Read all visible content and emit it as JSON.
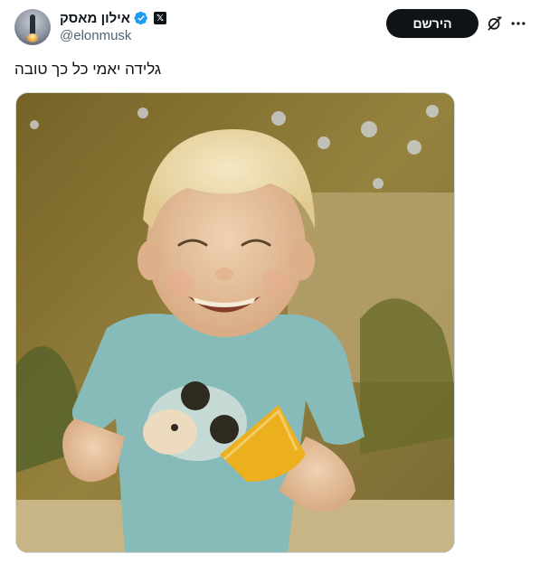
{
  "header": {
    "display_name": "אילון מאסק",
    "handle": "@elonmusk",
    "verified_icon": "verified-badge-icon",
    "platform_badge": "𝕏",
    "subscribe_label": "הירשם",
    "grok_icon": "grok-icon",
    "more_icon": "more-icon"
  },
  "tweet": {
    "text": "גלידה יאמי כל כך טובה"
  },
  "media": {
    "kind": "photo",
    "description_icon": "child-with-ice-cream-photo"
  },
  "colors": {
    "accent": "#1d9bf0",
    "button_bg": "#0f1419",
    "secondary_text": "#536471"
  }
}
